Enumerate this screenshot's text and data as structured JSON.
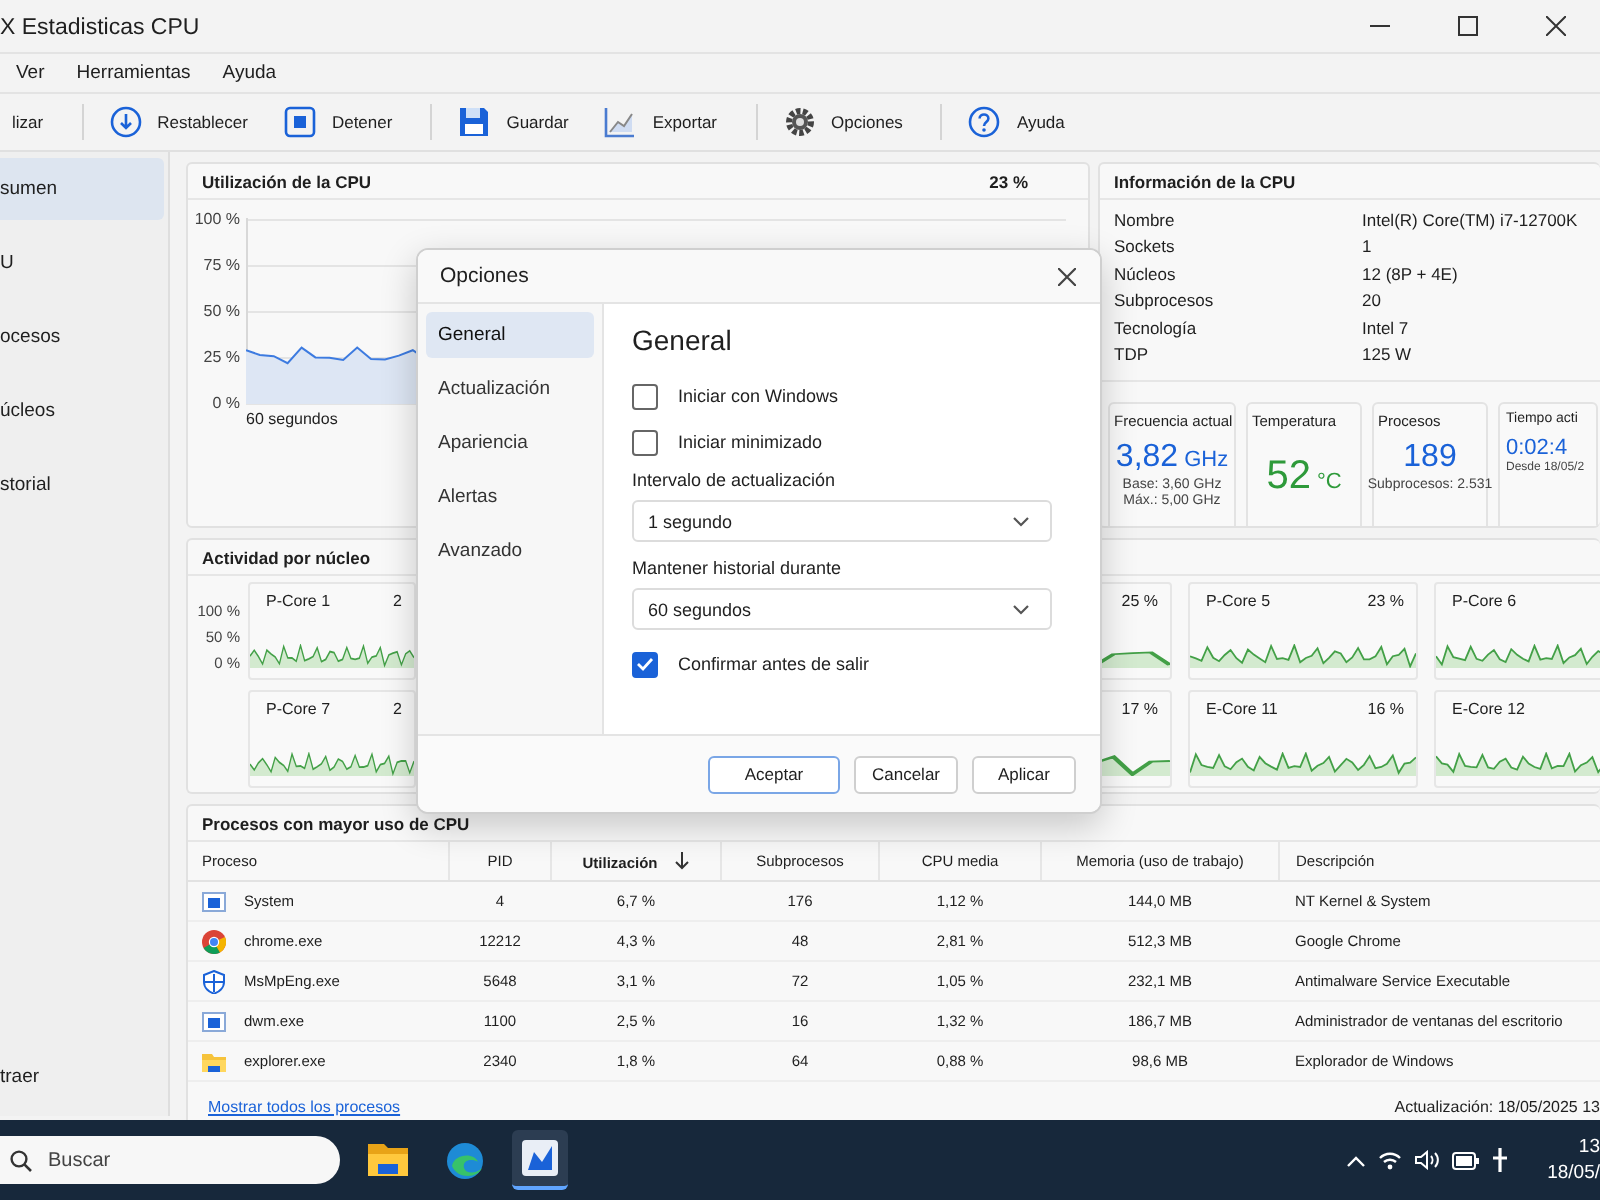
{
  "window": {
    "title": "X Estadisticas CPU"
  },
  "menu": [
    "Ver",
    "Herramientas",
    "Ayuda"
  ],
  "toolbar": [
    [
      {
        "label": "lizar",
        "kind": "plain"
      }
    ],
    [
      {
        "label": "Restablecer",
        "kind": "reset"
      },
      {
        "label": "Detener",
        "kind": "stop"
      }
    ],
    [
      {
        "label": "Guardar",
        "kind": "save"
      },
      {
        "label": "Exportar",
        "kind": "export"
      }
    ],
    [
      {
        "label": "Opciones",
        "kind": "settings"
      }
    ],
    [
      {
        "label": "Ayuda",
        "kind": "help"
      }
    ]
  ],
  "sidebar": {
    "items": [
      {
        "label": "sumen",
        "selected": true
      },
      {
        "label": "U",
        "selected": false
      },
      {
        "label": "ocesos",
        "selected": false
      },
      {
        "label": "úcleos",
        "selected": false
      },
      {
        "label": "storial",
        "selected": false
      }
    ],
    "footer": "traer"
  },
  "cpu_usage": {
    "title": "Utilización de la CPU",
    "reading": "23 %",
    "y_ticks": [
      "100 %",
      "75 %",
      "50 %",
      "25 %",
      "0 %"
    ],
    "x_label": "60 segundos"
  },
  "cpu_info": {
    "title": "Información de la CPU",
    "rows": [
      {
        "label": "Nombre",
        "value": "Intel(R) Core(TM) i7-12700K"
      },
      {
        "label": "Sockets",
        "value": "1"
      },
      {
        "label": "Núcleos",
        "value": "12 (8P + 4E)"
      },
      {
        "label": "Subprocesos",
        "value": "20"
      },
      {
        "label": "Tecnología",
        "value": "Intel 7"
      },
      {
        "label": "TDP",
        "value": "125 W"
      }
    ],
    "tiles": [
      {
        "title": "Frecuencia actual",
        "value": "3,82",
        "unit": "GHz",
        "color": "#1a62d8",
        "notes": [
          "Base: 3,60 GHz",
          "Máx.: 5,00 GHz"
        ]
      },
      {
        "title": "Temperatura",
        "value": "52",
        "unit": "°C",
        "color": "#2e9a3a"
      },
      {
        "title": "Procesos",
        "value": "189",
        "color": "#1a62d8",
        "notes": [
          "Subprocesos: 2.531"
        ]
      },
      {
        "title": "Tiempo acti",
        "value": "0:02:4",
        "color": "#1a62d8",
        "notes": [
          "Desde 18/05/2"
        ]
      }
    ]
  },
  "core_activity": {
    "title": "Actividad por núcleo",
    "y_ticks": [
      "100 %",
      "50 %",
      "0 %"
    ],
    "rows": [
      {
        "cores": [
          {
            "name": "P-Core 1",
            "reading": "2"
          },
          {
            "reading": "25 %"
          },
          {
            "name": "P-Core 5",
            "reading": "23 %"
          },
          {
            "name": "P-Core 6"
          }
        ]
      },
      {
        "cores": [
          {
            "name": "P-Core 7",
            "reading": "2"
          },
          {
            "reading": "17 %"
          },
          {
            "name": "E-Core 11",
            "reading": "16 %"
          },
          {
            "name": "E-Core 12"
          }
        ]
      }
    ]
  },
  "processes": {
    "title": "Procesos con mayor uso de CPU",
    "columns": [
      {
        "label": "Proceso",
        "sorted": false
      },
      {
        "label": "PID",
        "sorted": false
      },
      {
        "label": "Utilización",
        "sorted": true
      },
      {
        "label": "Subprocesos",
        "sorted": false
      },
      {
        "label": "CPU media",
        "sorted": false
      },
      {
        "label": "Memoria (uso de trabajo)",
        "sorted": false
      },
      {
        "label": "Descripción",
        "sorted": false
      }
    ],
    "rows": [
      {
        "kind": "system",
        "cells": [
          "System",
          "4",
          "6,7 %",
          "176",
          "1,12 %",
          "144,0 MB",
          "NT Kernel & System"
        ]
      },
      {
        "kind": "browser",
        "cells": [
          "chrome.exe",
          "12212",
          "4,3 %",
          "48",
          "2,81 %",
          "512,3 MB",
          "Google Chrome"
        ]
      },
      {
        "kind": "security",
        "cells": [
          "MsMpEng.exe",
          "5648",
          "3,1 %",
          "72",
          "1,05 %",
          "232,1 MB",
          "Antimalware Service Executable"
        ]
      },
      {
        "kind": "system",
        "cells": [
          "dwm.exe",
          "1100",
          "2,5 %",
          "16",
          "1,32 %",
          "186,7 MB",
          "Administrador de ventanas del escritorio"
        ]
      },
      {
        "kind": "explorer",
        "cells": [
          "explorer.exe",
          "2340",
          "1,8 %",
          "64",
          "0,88 %",
          "98,6 MB",
          "Explorador de Windows"
        ]
      }
    ],
    "link": "Mostrar todos los procesos",
    "updated": "Actualización: 18/05/2025 13"
  },
  "dialog": {
    "title": "Opciones",
    "nav": [
      {
        "label": "General",
        "selected": true
      },
      {
        "label": "Actualización",
        "selected": false
      },
      {
        "label": "Apariencia",
        "selected": false
      },
      {
        "label": "Alertas",
        "selected": false
      },
      {
        "label": "Avanzado",
        "selected": false
      }
    ],
    "heading": "General",
    "settings": [
      {
        "kind": "checkbox",
        "label": "Iniciar con Windows",
        "checked": false
      },
      {
        "kind": "checkbox",
        "label": "Iniciar minimizado",
        "checked": false
      },
      {
        "kind": "select",
        "label": "Intervalo de actualización",
        "value": "1 segundo"
      },
      {
        "kind": "select",
        "label": "Mantener historial durante",
        "value": "60 segundos"
      },
      {
        "kind": "checkbox",
        "label": "Confirmar antes de salir",
        "checked": true
      }
    ],
    "buttons": [
      {
        "label": "Aceptar",
        "primary": true
      },
      {
        "label": "Cancelar",
        "primary": false
      },
      {
        "label": "Aplicar",
        "primary": false
      }
    ]
  },
  "taskbar": {
    "search": {
      "placeholder": "Buscar"
    },
    "apps": [
      {
        "kind": "files",
        "active": false
      },
      {
        "kind": "browser",
        "active": false
      },
      {
        "kind": "monitor",
        "active": true
      }
    ],
    "clock": {
      "time": "13",
      "date": "18/05/"
    }
  }
}
